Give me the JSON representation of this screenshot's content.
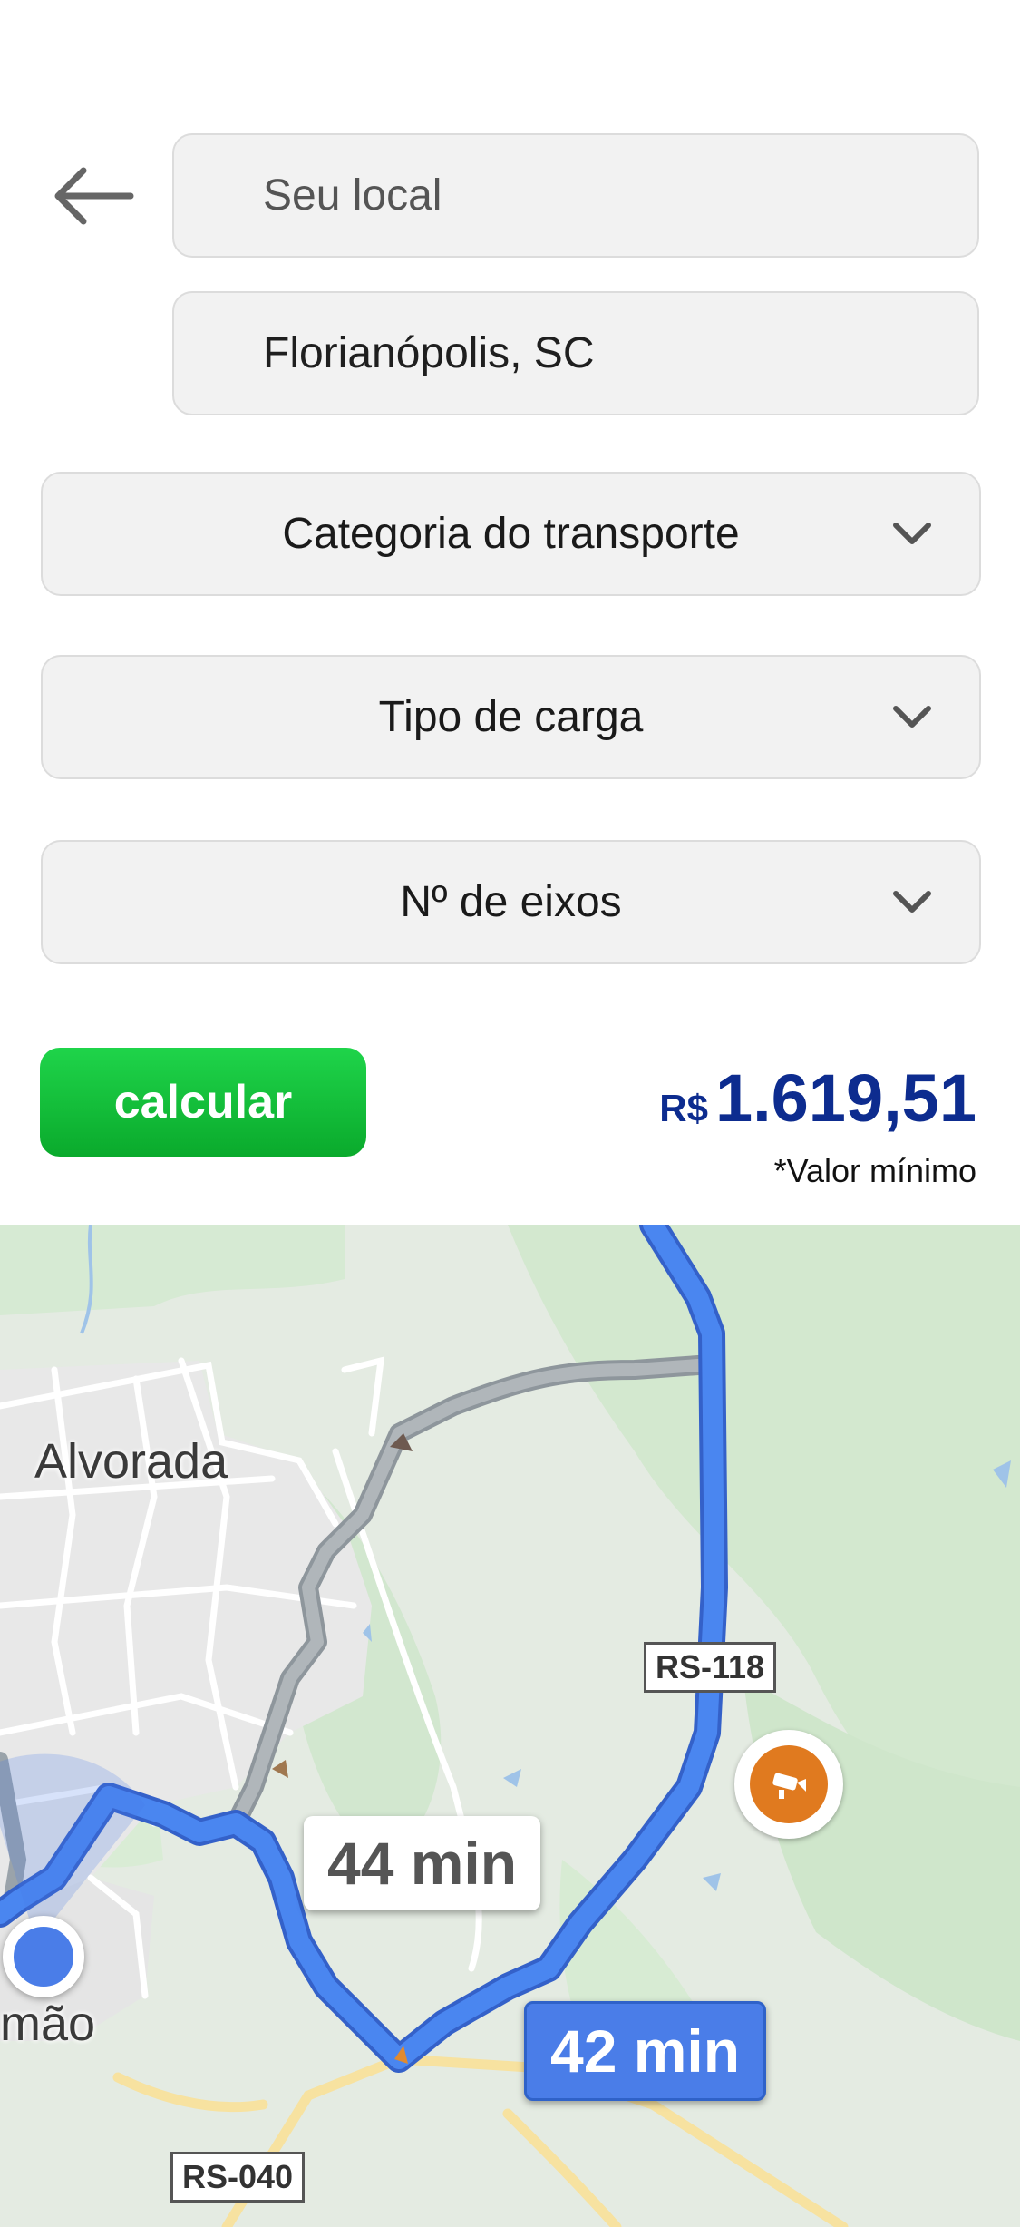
{
  "route": {
    "origin_placeholder": "Seu local",
    "destination_value": "Florianópolis, SC"
  },
  "filters": {
    "transport_category": "Categoria do transporte",
    "cargo_type": "Tipo de carga",
    "axles": "Nº de eixos"
  },
  "action": {
    "calculate_label": "calcular"
  },
  "result": {
    "currency": "R$",
    "value": "1.619,51",
    "note": "*Valor mínimo"
  },
  "map": {
    "places": {
      "alvorada": "Alvorada",
      "partial_city": "mão"
    },
    "roads": {
      "rs118": "RS-118",
      "rs040": "RS-040"
    },
    "times": {
      "alternative": "44 min",
      "main": "42 min"
    },
    "colors": {
      "route_main": "#4a7de8",
      "route_alt": "#9aa3aa",
      "camera": "#e07a1f"
    },
    "icons": {
      "camera": "speed-camera-icon",
      "location": "current-location-icon"
    }
  }
}
